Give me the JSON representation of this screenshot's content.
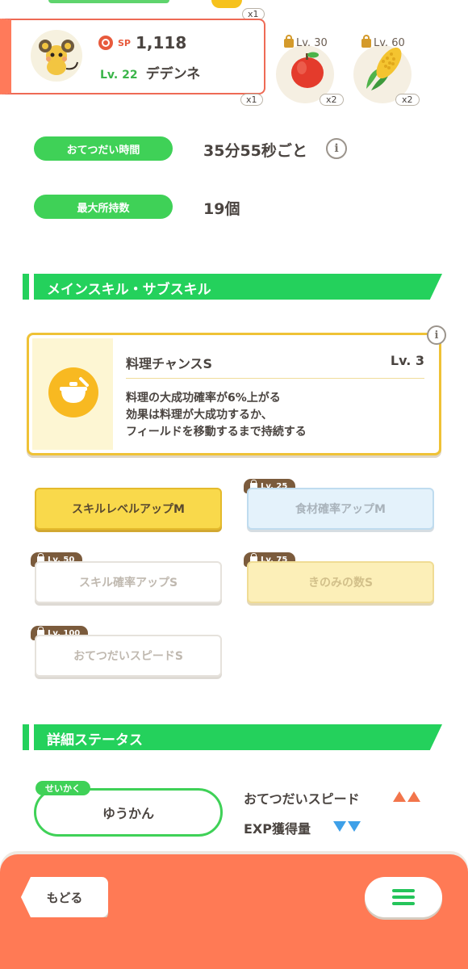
{
  "pokemon": {
    "sp_label": "SP",
    "sp_value": "1,118",
    "level": "Lv. 22",
    "name": "デデンネ",
    "top_count": "x1",
    "count": "x1"
  },
  "ingredients": [
    {
      "unlock_level": "Lv. 30",
      "icon": "apple-icon",
      "count": "x2"
    },
    {
      "unlock_level": "Lv. 60",
      "icon": "corn-icon",
      "count": "x2"
    }
  ],
  "info": {
    "help_time_label": "おてつだい時間",
    "help_time_value": "35分55秒ごと",
    "max_carry_label": "最大所持数",
    "max_carry_value": "19個",
    "info_glyph": "i"
  },
  "skills_section": {
    "title": "メインスキル・サブスキル",
    "main_skill": {
      "name": "料理チャンスS",
      "level": "Lv. 3",
      "desc_lines": [
        "料理の大成功確率が6%上がる",
        "効果は料理が大成功するか、",
        "フィールドを移動するまで持続する"
      ]
    },
    "sub_skills": [
      {
        "label": "スキルレベルアップM",
        "lock": ""
      },
      {
        "label": "食材確率アップM",
        "lock": "Lv. 25"
      },
      {
        "label": "スキル確率アップS",
        "lock": "Lv. 50"
      },
      {
        "label": "きのみの数S",
        "lock": "Lv. 75"
      },
      {
        "label": "おてつだいスピードS",
        "lock": "Lv. 100"
      }
    ]
  },
  "status_section": {
    "title": "詳細ステータス",
    "nature_tag": "せいかく",
    "nature": "ゆうかん",
    "up_stat": "おてつだいスピード",
    "down_stat": "EXP獲得量"
  },
  "footer": {
    "back_label": "もどる"
  },
  "colors": {
    "accent_green": "#24d15c",
    "accent_orange": "#ff7a55",
    "up_arrow": "#f2754b",
    "down_arrow": "#3ea0e8"
  }
}
